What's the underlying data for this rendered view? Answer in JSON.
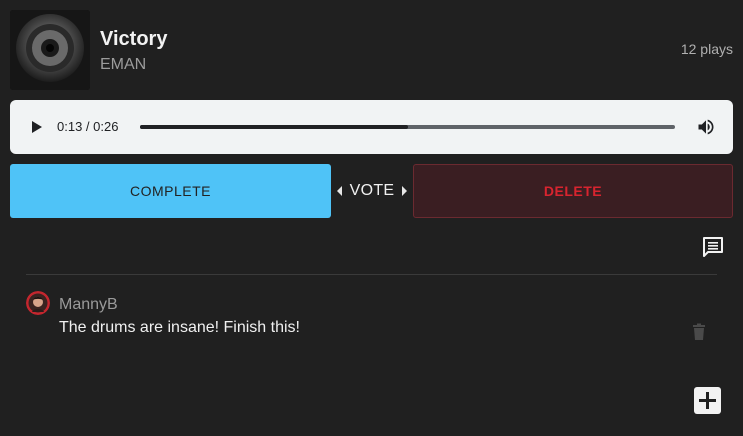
{
  "track": {
    "title": "Victory",
    "artist": "EMAN",
    "plays": "12 plays",
    "cover_icon": "speaker-cover-art"
  },
  "player": {
    "time_display": "0:13 / 0:26",
    "progress_fraction": 0.5,
    "play_icon": "play-icon",
    "volume_icon": "volume-icon"
  },
  "vote": {
    "complete_label": "COMPLETE",
    "vote_label": "VOTE",
    "delete_label": "DELETE",
    "colors": {
      "complete": "#4fc3f7",
      "delete_text": "#d8242f",
      "delete_bg": "#3a1e22"
    }
  },
  "comments": {
    "toggle_icon": "comments-list-icon",
    "items": [
      {
        "author": "MannyB",
        "text": "The drums are insane! Finish this!",
        "avatar_icon": "avatar",
        "delete_icon": "trash-icon"
      }
    ],
    "add_icon": "plus-icon"
  }
}
